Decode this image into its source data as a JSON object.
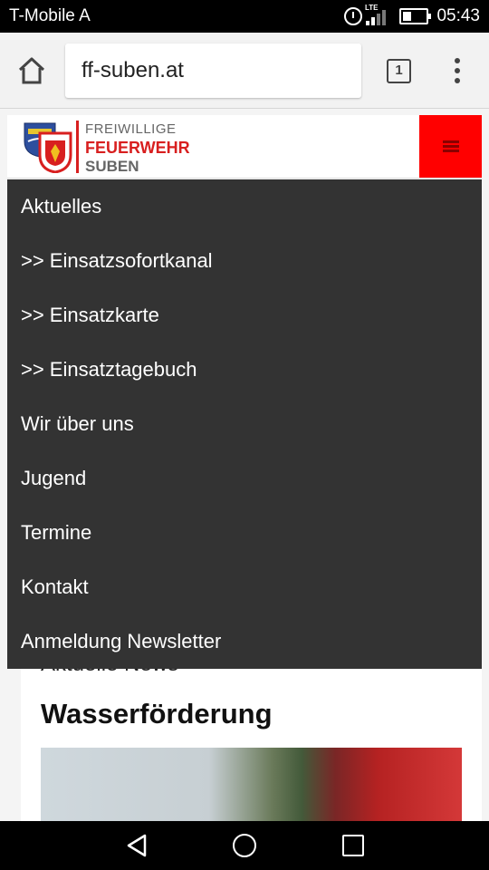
{
  "status_bar": {
    "carrier": "T-Mobile A",
    "network": "LTE",
    "time": "05:43"
  },
  "browser": {
    "url": "ff-suben.at",
    "tab_count": "1"
  },
  "site": {
    "logo_line1": "FREIWILLIGE",
    "logo_line2": "FEUERWEHR",
    "logo_line3": "SUBEN",
    "brand_color": "#ff0000"
  },
  "nav_menu": {
    "items": [
      "Aktuelles",
      ">> Einsatzsofortkanal",
      ">> Einsatzkarte",
      ">> Einsatztagebuch",
      "Wir über uns",
      "Jugend",
      "Termine",
      "Kontakt",
      "Anmeldung Newsletter"
    ]
  },
  "content": {
    "section_heading": "Aktuelle News",
    "post_title": "Wasserförderung"
  }
}
